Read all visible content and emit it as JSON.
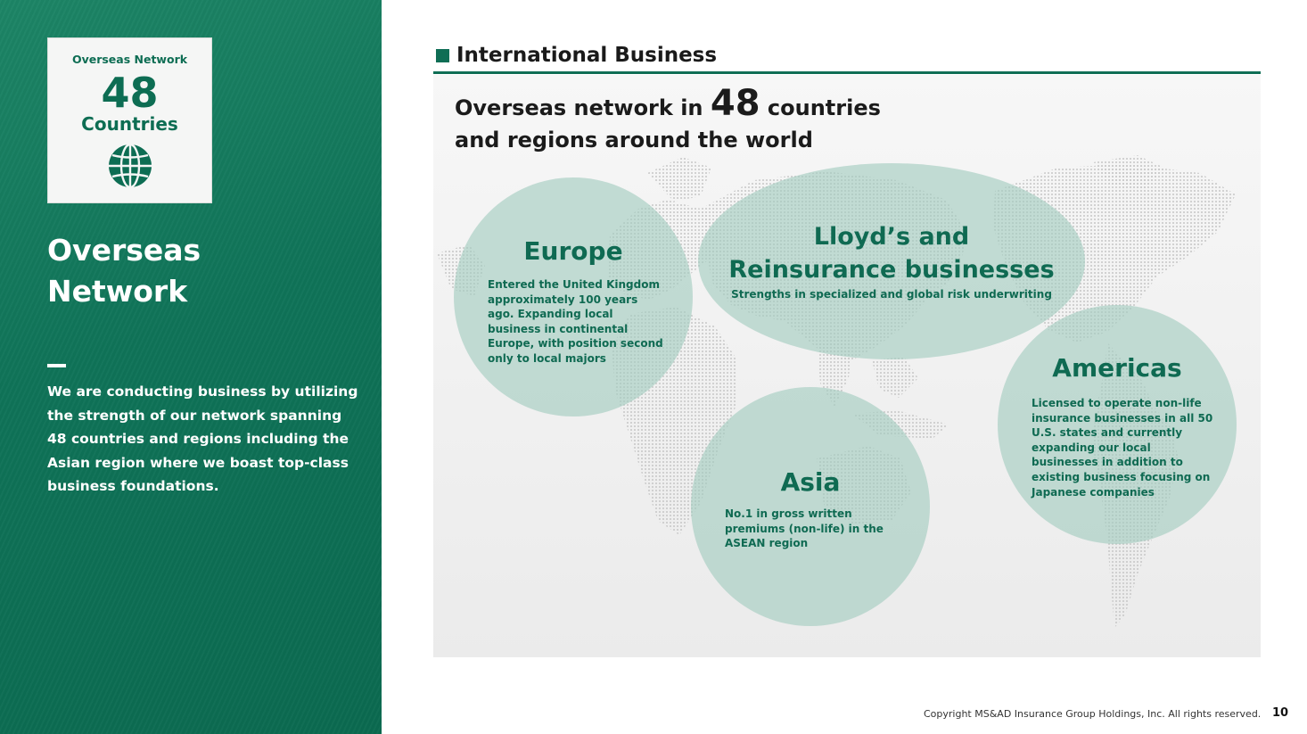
{
  "sidebar": {
    "badge_title": "Overseas Network",
    "badge_number": "48",
    "badge_unit": "Countries",
    "badge_icon": "globe-icon",
    "section_title_line1": "Overseas",
    "section_title_line2": "Network",
    "description": "We are conducting business by utilizing the strength of our network spanning 48 countries and regions including the Asian region where we boast top-class business foundations."
  },
  "main": {
    "heading": "International Business",
    "headline_prefix": "Overseas network in",
    "headline_number": "48",
    "headline_suffix": "countries",
    "headline_line2": "and regions around the world",
    "bubbles": [
      {
        "id": "europe",
        "title": "Europe",
        "text": "Entered the United Kingdom approximately 100 years ago. Expanding local business in continental Europe, with position second only to local majors"
      },
      {
        "id": "lloyds",
        "title_line1": "Lloyd’s and",
        "title_line2": "Reinsurance businesses",
        "text": "Strengths in specialized and global risk underwriting"
      },
      {
        "id": "asia",
        "title": "Asia",
        "text": "No.1 in gross written premiums (non-life) in the ASEAN region"
      },
      {
        "id": "americas",
        "title": "Americas",
        "text": "Licensed to operate non-life insurance businesses in all 50 U.S. states and currently expanding our local businesses in addition to existing business focusing on Japanese companies"
      }
    ]
  },
  "footer": {
    "copyright": "Copyright MS&AD Insurance Group Holdings, Inc. All rights reserved.",
    "page_number": "10"
  },
  "colors": {
    "brand_green": "#0f6e55",
    "bubble_fill": "#a2ccbf",
    "map_dots": "#c8c8c8"
  }
}
